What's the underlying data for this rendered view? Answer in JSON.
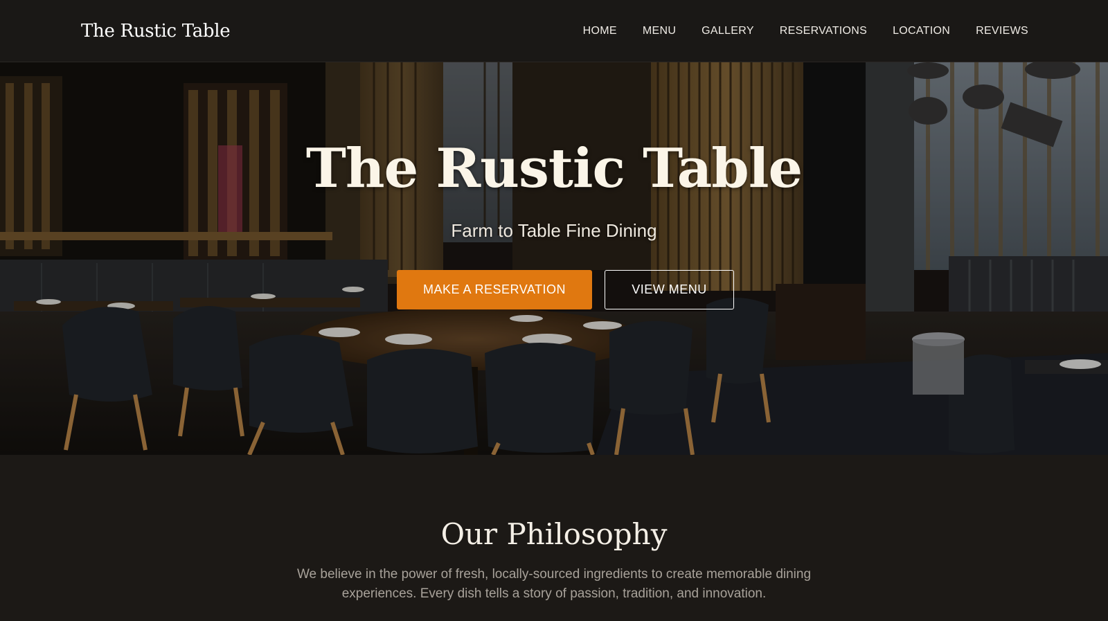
{
  "header": {
    "brand": "The Rustic Table",
    "nav": [
      "HOME",
      "MENU",
      "GALLERY",
      "RESERVATIONS",
      "LOCATION",
      "REVIEWS"
    ]
  },
  "hero": {
    "title": "The Rustic Table",
    "subtitle": "Farm to Table Fine Dining",
    "primary_button": "MAKE A RESERVATION",
    "secondary_button": "VIEW MENU",
    "background_image": "restaurant-interior-photo"
  },
  "philosophy": {
    "heading": "Our Philosophy",
    "body": "We believe in the power of fresh, locally-sourced ingredients to create memorable dining experiences. Every dish tells a story of passion, tradition, and innovation."
  },
  "colors": {
    "accent": "#e07810",
    "page_background": "#1c1916",
    "header_background": "#1a1816"
  }
}
